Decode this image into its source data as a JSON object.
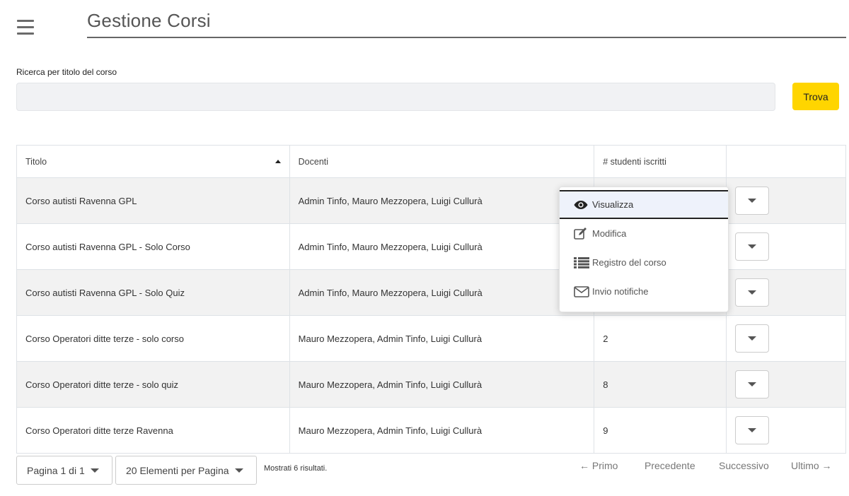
{
  "header": {
    "title": "Gestione Corsi"
  },
  "search": {
    "label": "Ricerca per titolo del corso",
    "value": "",
    "placeholder": "",
    "button_label": "Trova"
  },
  "colors": {
    "accent": "#ffd500",
    "active_item": "#eef2fb"
  },
  "table": {
    "columns": [
      "Titolo",
      "Docenti",
      "# studenti iscritti",
      ""
    ],
    "rows": [
      {
        "title": "Corso autisti Ravenna GPL",
        "teachers": "Admin Tinfo, Mauro Mezzopera, Luigi Cullurà",
        "students": ""
      },
      {
        "title": "Corso autisti Ravenna GPL - Solo Corso",
        "teachers": "Admin Tinfo, Mauro Mezzopera, Luigi Cullurà",
        "students": ""
      },
      {
        "title": "Corso autisti Ravenna GPL - Solo Quiz",
        "teachers": "Admin Tinfo, Mauro Mezzopera, Luigi Cullurà",
        "students": ""
      },
      {
        "title": "Corso Operatori ditte terze - solo corso",
        "teachers": "Mauro Mezzopera, Admin Tinfo, Luigi Cullurà",
        "students": "2"
      },
      {
        "title": "Corso Operatori ditte terze - solo quiz",
        "teachers": "Mauro Mezzopera, Admin Tinfo, Luigi Cullurà",
        "students": "8"
      },
      {
        "title": "Corso Operatori ditte terze Ravenna",
        "teachers": "Mauro Mezzopera, Admin Tinfo, Luigi Cullurà",
        "students": "9"
      }
    ]
  },
  "context_menu": {
    "items": [
      {
        "label": "Visualizza",
        "icon": "eye-icon",
        "active": true
      },
      {
        "label": "Modifica",
        "icon": "edit-icon",
        "active": false
      },
      {
        "label": "Registro del corso",
        "icon": "list-icon",
        "active": false
      },
      {
        "label": "Invio notifiche",
        "icon": "envelope-icon",
        "active": false
      }
    ]
  },
  "pagination": {
    "page_select": "Pagina 1 di 1",
    "per_page_select": "20 Elementi per Pagina",
    "results_text": "Mostrati 6 risultati.",
    "first": "← Primo",
    "previous": "Precedente",
    "next": "Successivo",
    "last": "Ultimo →"
  }
}
